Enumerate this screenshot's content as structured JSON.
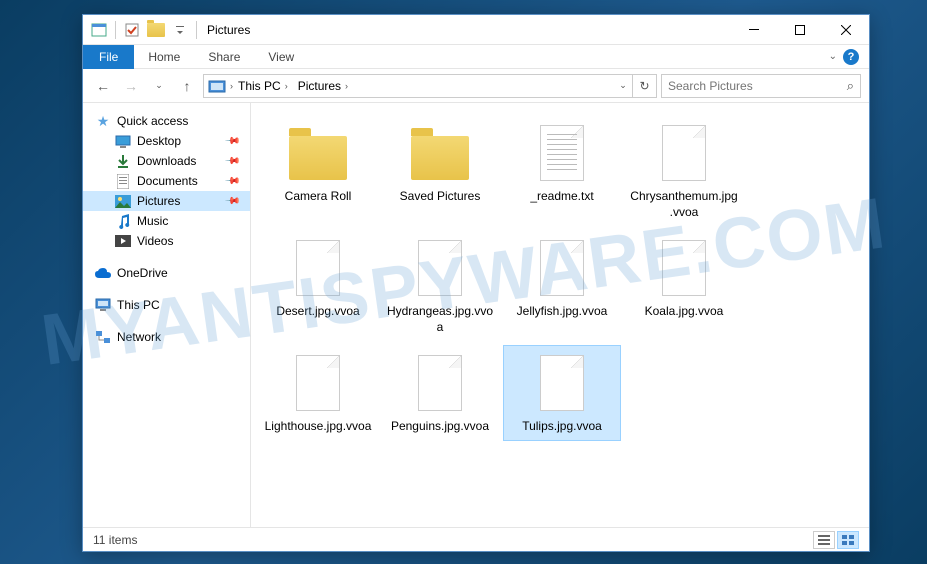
{
  "window": {
    "title": "Pictures"
  },
  "ribbon": {
    "file": "File",
    "tabs": [
      "Home",
      "Share",
      "View"
    ]
  },
  "address": {
    "segments": [
      "This PC",
      "Pictures"
    ]
  },
  "search": {
    "placeholder": "Search Pictures"
  },
  "sidebar": {
    "quick_access": {
      "label": "Quick access",
      "items": [
        {
          "label": "Desktop",
          "icon": "desktop",
          "pinned": true
        },
        {
          "label": "Downloads",
          "icon": "downloads",
          "pinned": true
        },
        {
          "label": "Documents",
          "icon": "documents",
          "pinned": true
        },
        {
          "label": "Pictures",
          "icon": "pictures",
          "pinned": true,
          "selected": true
        },
        {
          "label": "Music",
          "icon": "music",
          "pinned": false
        },
        {
          "label": "Videos",
          "icon": "videos",
          "pinned": false
        }
      ]
    },
    "onedrive": {
      "label": "OneDrive"
    },
    "thispc": {
      "label": "This PC"
    },
    "network": {
      "label": "Network"
    }
  },
  "items": [
    {
      "name": "Camera Roll",
      "type": "folder"
    },
    {
      "name": "Saved Pictures",
      "type": "folder"
    },
    {
      "name": "_readme.txt",
      "type": "text"
    },
    {
      "name": "Chrysanthemum.jpg.vvoa",
      "type": "file"
    },
    {
      "name": "Desert.jpg.vvoa",
      "type": "file"
    },
    {
      "name": "Hydrangeas.jpg.vvoa",
      "type": "file"
    },
    {
      "name": "Jellyfish.jpg.vvoa",
      "type": "file"
    },
    {
      "name": "Koala.jpg.vvoa",
      "type": "file"
    },
    {
      "name": "Lighthouse.jpg.vvoa",
      "type": "file"
    },
    {
      "name": "Penguins.jpg.vvoa",
      "type": "file"
    },
    {
      "name": "Tulips.jpg.vvoa",
      "type": "file",
      "selected": true
    }
  ],
  "status": {
    "count": "11 items"
  },
  "watermark": "MYANTISPYWARE.COM"
}
